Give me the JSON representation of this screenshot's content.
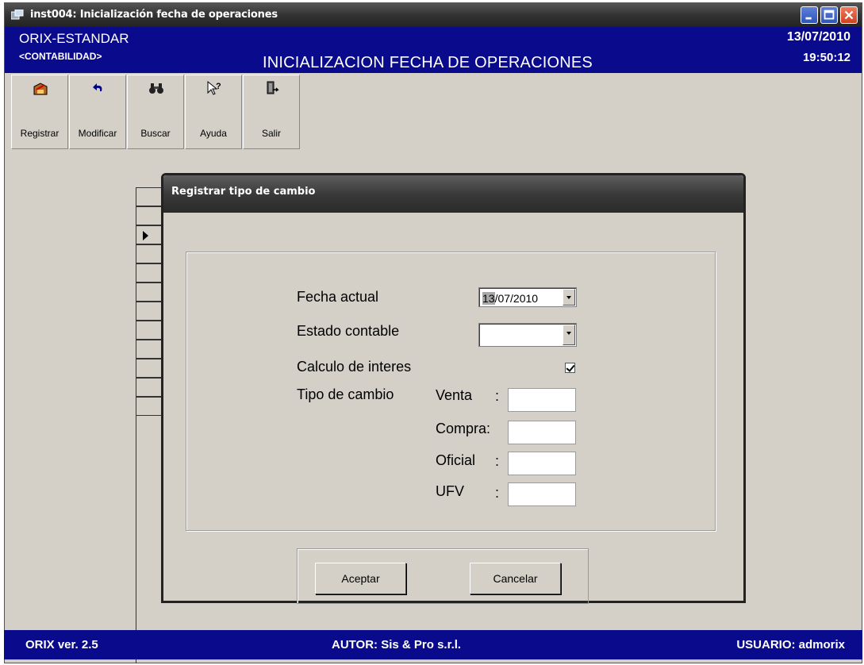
{
  "window": {
    "title": "inst004: Inicialización fecha de operaciones"
  },
  "header": {
    "app_name": "ORIX-ESTANDAR",
    "module": "<CONTABILIDAD>",
    "screen_title": "INICIALIZACION FECHA DE OPERACIONES",
    "date": "13/07/2010",
    "time": "19:50:12"
  },
  "toolbar": {
    "items": [
      {
        "label": "Registrar",
        "icon": "register-icon"
      },
      {
        "label": "Modificar",
        "icon": "undo-icon"
      },
      {
        "label": "Buscar",
        "icon": "binoculars-icon"
      },
      {
        "label": "Ayuda",
        "icon": "help-pointer-icon"
      },
      {
        "label": "Salir",
        "icon": "exit-door-icon"
      }
    ]
  },
  "dialog": {
    "title": "Registrar tipo de cambio",
    "fields": {
      "fecha_label": "Fecha actual",
      "fecha_day": "13",
      "fecha_rest": "/07/2010",
      "estado_label": "Estado contable",
      "estado_value": "",
      "calculo_label": "Calculo de interes",
      "calculo_checked": true,
      "tipo_label": "Tipo de cambio",
      "venta_label": "Venta",
      "venta_colon": ":",
      "venta_value": "",
      "compra_label": "Compra:",
      "compra_value": "",
      "oficial_label": "Oficial",
      "oficial_colon": ":",
      "oficial_value": "",
      "ufv_label": "UFV",
      "ufv_colon": ":",
      "ufv_value": ""
    },
    "buttons": {
      "accept": "Aceptar",
      "cancel": "Cancelar"
    }
  },
  "statusbar": {
    "version": "ORIX ver. 2.5",
    "author": "AUTOR: Sis & Pro s.r.l.",
    "user": "USUARIO: admorix"
  },
  "colors": {
    "header_bg": "#0a0a8c",
    "window_bg": "#d4d0c8",
    "titlebar_bg": "#333333"
  }
}
